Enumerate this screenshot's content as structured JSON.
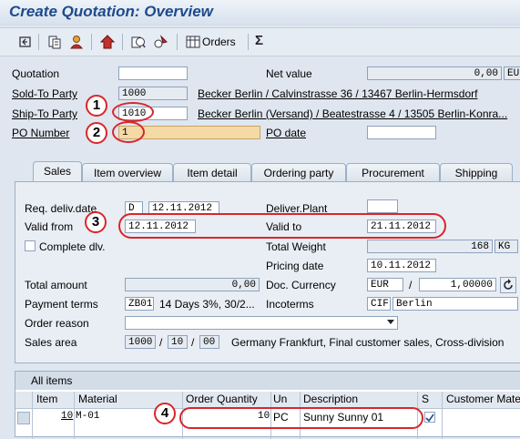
{
  "title": "Create Quotation: Overview",
  "toolbar": {
    "icons": [
      "display-change-icon",
      "header-icon",
      "partner-icon",
      "item-detail-icon",
      "copy-icon",
      "config-icon"
    ],
    "orders_label": "Orders",
    "sigma_label": "Σ"
  },
  "header": {
    "quotation_label": "Quotation",
    "quotation_value": "",
    "net_value_label": "Net value",
    "net_value": "0,00",
    "net_value_currency": "EUR",
    "sold_to_label": "Sold-To Party",
    "sold_to_value": "1000",
    "sold_to_desc": "Becker Berlin / Calvinstrasse 36 / 13467 Berlin-Hermsdorf",
    "ship_to_label": "Ship-To Party",
    "ship_to_value": "1010",
    "ship_to_desc": "Becker Berlin (Versand) / Beatestrasse 4 / 13505 Berlin-Konra...",
    "po_number_label": "PO Number",
    "po_number_value": "1",
    "po_date_label": "PO date",
    "po_date_value": ""
  },
  "tabs": [
    "Sales",
    "Item overview",
    "Item detail",
    "Ordering party",
    "Procurement",
    "Shipping"
  ],
  "sales": {
    "req_deliv_label": "Req. deliv.date",
    "req_deliv_type": "D",
    "req_deliv_date": "12.11.2012",
    "deliver_plant_label": "Deliver.Plant",
    "deliver_plant_value": "",
    "valid_from_label": "Valid from",
    "valid_from_value": "12.11.2012",
    "valid_to_label": "Valid to",
    "valid_to_value": "21.11.2012",
    "complete_dlv_label": "Complete dlv.",
    "total_weight_label": "Total Weight",
    "total_weight_value": "168",
    "total_weight_unit": "KG",
    "pricing_date_label": "Pricing date",
    "pricing_date_value": "10.11.2012",
    "total_amount_label": "Total amount",
    "total_amount_value": "0,00",
    "doc_currency_label": "Doc. Currency",
    "doc_currency_value": "EUR",
    "exchange_rate": "1,00000",
    "payment_terms_label": "Payment terms",
    "payment_terms_code": "ZB01",
    "payment_terms_desc": "14 Days 3%, 30/2...",
    "incoterms_label": "Incoterms",
    "incoterms_code": "CIF",
    "incoterms_place": "Berlin",
    "order_reason_label": "Order reason",
    "order_reason_value": "",
    "sales_area_label": "Sales area",
    "sales_org": "1000",
    "dist_channel": "10",
    "division": "00",
    "sales_area_desc": "Germany Frankfurt, Final customer sales, Cross-division"
  },
  "items": {
    "title": "All items",
    "columns": [
      "Item",
      "Material",
      "Order Quantity",
      "Un",
      "Description",
      "S",
      "Customer Mate"
    ],
    "rows": [
      {
        "item": "10",
        "material": "M-01",
        "quantity": "10",
        "unit": "PC",
        "description": "Sunny Sunny 01"
      }
    ]
  },
  "annotations": [
    "1",
    "2",
    "3",
    "4"
  ]
}
